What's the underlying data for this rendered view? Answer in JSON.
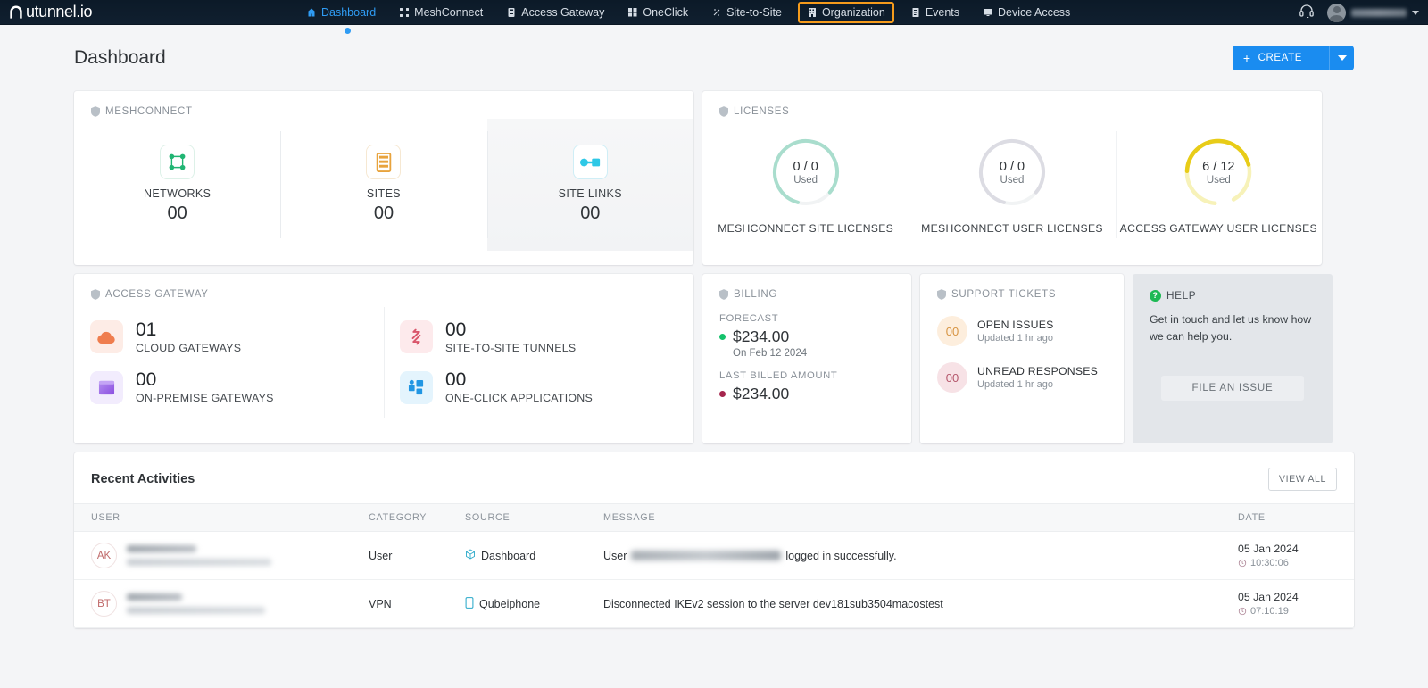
{
  "navbar": {
    "brand": "utunnel.io",
    "brand_icon": "tunnel-logo-icon",
    "items": [
      {
        "label": "Dashboard",
        "icon": "home-icon",
        "active": true
      },
      {
        "label": "MeshConnect",
        "icon": "mesh-icon",
        "active": false
      },
      {
        "label": "Access Gateway",
        "icon": "gateway-icon",
        "active": false
      },
      {
        "label": "OneClick",
        "icon": "oneclick-icon",
        "active": false
      },
      {
        "label": "Site-to-Site",
        "icon": "site-to-site-icon",
        "active": false
      },
      {
        "label": "Organization",
        "icon": "organization-icon",
        "active": false,
        "highlighted": true
      },
      {
        "label": "Events",
        "icon": "events-icon",
        "active": false
      },
      {
        "label": "Device Access",
        "icon": "device-access-icon",
        "active": false
      }
    ],
    "support_icon": "headset-icon",
    "avatar_icon": "user-avatar-icon",
    "caret_icon": "chevron-down-icon",
    "highlight_color": "#f59b1c",
    "active_color": "#2f9cf4"
  },
  "header": {
    "title": "Dashboard",
    "create_label": "CREATE",
    "create_plus_icon": "plus-icon",
    "create_caret_icon": "chevron-down-icon",
    "create_color": "#1a8cf0"
  },
  "meshconnect": {
    "label": "MESHCONNECT",
    "shield_icon": "shield-icon",
    "tiles": [
      {
        "name": "NETWORKS",
        "value": "00",
        "icon": "network-nodes-icon",
        "color": "#21b573"
      },
      {
        "name": "SITES",
        "value": "00",
        "icon": "sites-stack-icon",
        "color": "#e8a33d"
      },
      {
        "name": "SITE LINKS",
        "value": "00",
        "icon": "site-link-icon",
        "color": "#2ec8e6"
      }
    ]
  },
  "licenses": {
    "label": "LICENSES",
    "shield_icon": "shield-icon",
    "tiles": [
      {
        "name": "MESHCONNECT SITE LICENSES",
        "value": "0 / 0",
        "sub": "Used",
        "used": 0,
        "total": 0,
        "color": "#9fd9c7",
        "track": "#f0f2f3"
      },
      {
        "name": "MESHCONNECT USER LICENSES",
        "value": "0 / 0",
        "sub": "Used",
        "used": 0,
        "total": 0,
        "color": "#d9d9e0",
        "track": "#f0f2f3"
      },
      {
        "name": "ACCESS GATEWAY USER LICENSES",
        "value": "6 / 12",
        "sub": "Used",
        "used": 6,
        "total": 12,
        "color": "#e8cc18",
        "track": "#f7f2b9"
      }
    ]
  },
  "access_gateway": {
    "label": "ACCESS GATEWAY",
    "shield_icon": "shield-icon",
    "items": [
      {
        "value": "01",
        "name": "CLOUD GATEWAYS",
        "icon": "cloud-icon",
        "bg": "#fdece6",
        "fg": "#ef7d4e"
      },
      {
        "value": "00",
        "name": "ON-PREMISE GATEWAYS",
        "icon": "server-icon",
        "bg": "#f2ecfd",
        "fg": "#9561e8"
      },
      {
        "value": "00",
        "name": "SITE-TO-SITE TUNNELS",
        "icon": "arrows-exchange-icon",
        "bg": "#fdeaec",
        "fg": "#d9566b"
      },
      {
        "value": "00",
        "name": "ONE-CLICK APPLICATIONS",
        "icon": "apps-grid-icon",
        "bg": "#e4f4fd",
        "fg": "#2196e3"
      }
    ]
  },
  "billing": {
    "label": "BILLING",
    "shield_icon": "shield-icon",
    "forecast_label": "FORECAST",
    "forecast_amount": "$234.00",
    "forecast_dot_color": "#13c26b",
    "forecast_on": "On Feb 12 2024",
    "last_billed_label": "LAST BILLED AMOUNT",
    "last_billed_amount": "$234.00",
    "last_billed_dot_color": "#a5254d"
  },
  "support_tickets": {
    "label": "SUPPORT TICKETS",
    "shield_icon": "shield-icon",
    "items": [
      {
        "count": "00",
        "title": "OPEN ISSUES",
        "sub": "Updated 1 hr ago",
        "bg": "#fdeedd",
        "fg": "#d79442"
      },
      {
        "count": "00",
        "title": "UNREAD RESPONSES",
        "sub": "Updated 1 hr ago",
        "bg": "#f7e2e6",
        "fg": "#b5576c"
      }
    ]
  },
  "help": {
    "label": "HELP",
    "help_icon": "question-circle-icon",
    "text": "Get in touch and let us know how we can help you.",
    "button_label": "FILE AN ISSUE"
  },
  "recent_activities": {
    "title": "Recent Activities",
    "view_all_label": "VIEW ALL",
    "columns": [
      "USER",
      "CATEGORY",
      "SOURCE",
      "MESSAGE",
      "DATE"
    ],
    "rows": [
      {
        "initials": "AK",
        "category": "User",
        "source": "Dashboard",
        "source_icon": "cube-icon",
        "message_prefix": "User",
        "message_suffix": "logged in successfully.",
        "date": "05 Jan 2024",
        "time": "10:30:06",
        "time_icon": "clock-icon"
      },
      {
        "initials": "BT",
        "category": "VPN",
        "source": "Qubeiphone",
        "source_icon": "mobile-icon",
        "message_prefix": "",
        "message_full": "Disconnected IKEv2 session to the server dev181sub3504macostest",
        "message_suffix": "",
        "date": "05 Jan 2024",
        "time": "07:10:19",
        "time_icon": "clock-icon"
      }
    ]
  }
}
